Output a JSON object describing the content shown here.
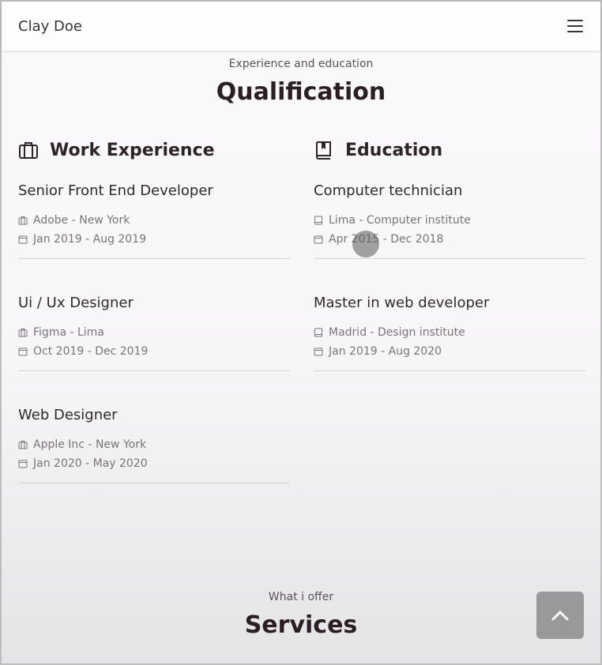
{
  "header": {
    "brand": "Clay Doe",
    "menu_icon": "hamburger-menu-icon"
  },
  "qualification": {
    "subtitle": "Experience and education",
    "title": "Qualification",
    "work": {
      "heading": "Work Experience",
      "icon": "briefcase-icon",
      "items": [
        {
          "title": "Senior Front End Developer",
          "place": "Adobe - New York",
          "dates": "Jan 2019 - Aug 2019"
        },
        {
          "title": "Ui / Ux Designer",
          "place": "Figma - Lima",
          "dates": "Oct 2019 - Dec 2019"
        },
        {
          "title": "Web Designer",
          "place": "Apple Inc - New York",
          "dates": "Jan 2020 - May 2020"
        }
      ]
    },
    "education": {
      "heading": "Education",
      "icon": "book-icon",
      "items": [
        {
          "title": "Computer technician",
          "place": "Lima - Computer institute",
          "dates": "Apr 2015 - Dec 2018"
        },
        {
          "title": "Master in web developer",
          "place": "Madrid - Design institute",
          "dates": "Jan 2019 - Aug 2020"
        }
      ]
    }
  },
  "services": {
    "subtitle": "What i offer",
    "title": "Services"
  },
  "scroll_up": {
    "icon": "chevron-up-icon"
  }
}
